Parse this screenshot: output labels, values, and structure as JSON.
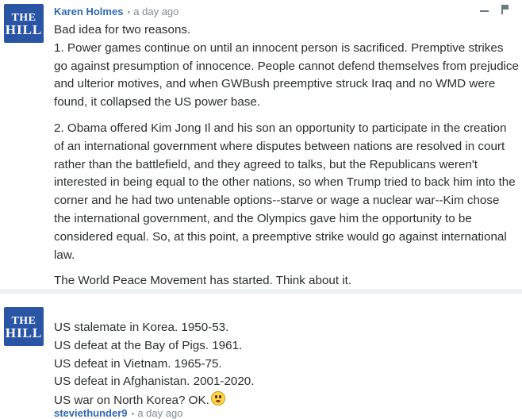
{
  "comments": [
    {
      "avatar_text": [
        "THE",
        "HILL"
      ],
      "author": "Karen Holmes",
      "separator": "•",
      "time": "a day ago",
      "paragraphs": [
        [
          "Bad idea for two reasons.",
          "1. Power games continue on until an innocent person is sacrificed. Premptive strikes go against presumption of innocence. People cannot defend themselves from prejudice and ulterior motives, and when GWBush preemptive struck Iraq and no WMD were found, it collapsed the US power base."
        ],
        [
          "2. Obama offered Kim Jong Il and his son an opportunity to participate in the creation of an international government where disputes between nations are resolved in court rather than the battlefield, and they agreed to talks, but the Republicans weren't interested in being equal to the other nations, so when Trump tried to back him into the corner and he had two untenable options--starve or wage a nuclear war--Kim chose the international government, and the Olympics gave him the opportunity to be considered equal. So, at this point, a preemptive strike would go against international law."
        ],
        [
          "The World Peace Movement has started. Think about it."
        ]
      ]
    },
    {
      "avatar_text": [
        "THE",
        "HILL"
      ],
      "author": "steviethunder9",
      "separator": "•",
      "time": "a day ago",
      "lines": [
        "US stalemate in Korea. 1950-53.",
        "US defeat at the Bay of Pigs. 1961.",
        "US defeat in Vietnam. 1965-75.",
        "US defeat in Afghanistan. 2001-2020.",
        "US war on North Korea? OK."
      ],
      "emoji": "flushed-face-emoji"
    }
  ],
  "actions": {
    "collapse": "collapse-icon",
    "flag": "flag-icon"
  }
}
